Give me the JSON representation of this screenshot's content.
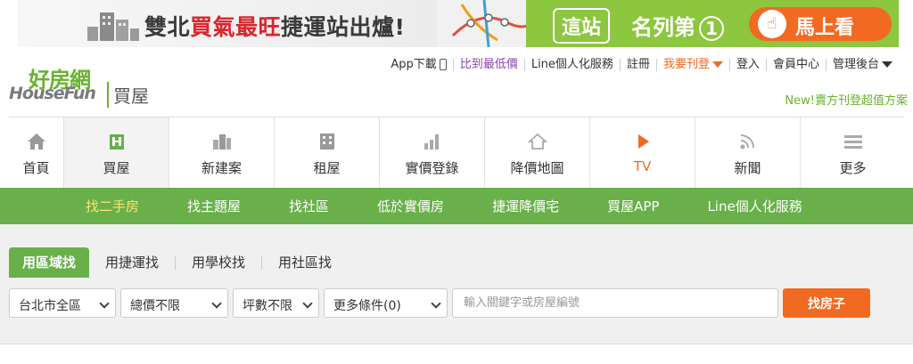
{
  "banner": {
    "text_prefix": "雙北",
    "text_highlight": "買氣最旺",
    "text_suffix": "捷運站出爐!",
    "station_label": "這站",
    "rank_label": "名列第",
    "rank_number": "1",
    "cta_label": "馬上看",
    "cta_icon": "hand-pointer-icon"
  },
  "logo": {
    "cn": "好房網",
    "en": "HouseFun",
    "sub": "買屋"
  },
  "top_nav": {
    "app_download": "App下載",
    "lowest_price": "比到最低價",
    "line_service": "Line個人化服務",
    "register": "註冊",
    "post_ad": "我要刊登",
    "login": "登入",
    "member_center": "會員中心",
    "admin_backend": "管理後台"
  },
  "promo_text": "New!賣方刊登超值方案",
  "main_nav": [
    {
      "label": "首頁",
      "icon": "home-icon"
    },
    {
      "label": "買屋",
      "icon": "house-icon"
    },
    {
      "label": "新建案",
      "icon": "buildings-icon"
    },
    {
      "label": "租屋",
      "icon": "apartment-icon"
    },
    {
      "label": "實價登錄",
      "icon": "bar-chart-icon"
    },
    {
      "label": "降價地圖",
      "icon": "house-outline-icon"
    },
    {
      "label": "TV",
      "icon": "play-icon"
    },
    {
      "label": "新聞",
      "icon": "rss-icon"
    },
    {
      "label": "更多",
      "icon": "menu-icon"
    }
  ],
  "sub_nav": [
    "找二手房",
    "找主題屋",
    "找社區",
    "低於實價房",
    "捷運降價宅",
    "買屋APP",
    "Line個人化服務"
  ],
  "search_tabs": [
    "用區域找",
    "用捷運找",
    "用學校找",
    "用社區找"
  ],
  "filters": {
    "region": "台北市全區",
    "price": "總價不限",
    "size": "坪數不限",
    "more": "更多條件(0)"
  },
  "search": {
    "placeholder": "輸入關鍵字或房屋編號",
    "button": "找房子"
  },
  "colors": {
    "brand_green": "#69b04b",
    "accent_orange": "#f26a21",
    "banner_green": "#8dc63f",
    "highlight_red": "#d8262e"
  }
}
